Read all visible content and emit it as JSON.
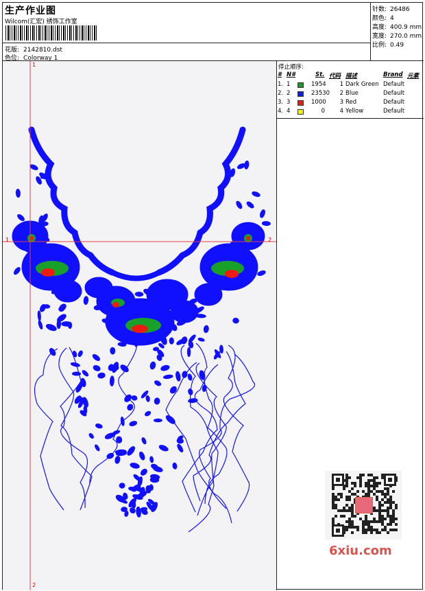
{
  "header": {
    "title": "生产作业图",
    "company": "Wilcom(汇宏) 绣饰工作室",
    "design_label": "花版:",
    "design_value": "2142810.dst",
    "colorway_label": "色位:",
    "colorway_value": "Colorway 1"
  },
  "specs": [
    {
      "label": "针数:",
      "value": "26486"
    },
    {
      "label": "颜色:",
      "value": "4"
    },
    {
      "label": "高度:",
      "value": "400.9 mm"
    },
    {
      "label": "宽度:",
      "value": "270.0 mm"
    },
    {
      "label": "比例:",
      "value": "0.49"
    }
  ],
  "stop_sequence": {
    "title": "停止顺序:",
    "columns": [
      "#",
      "N#",
      "St.",
      "代码",
      "描述",
      "Brand",
      "元素"
    ],
    "rows": [
      {
        "idx": "1.",
        "n": "1",
        "color": "#1a9a2a",
        "st": "1954",
        "code": "1",
        "desc": "Dark Green",
        "brand": "Default"
      },
      {
        "idx": "2.",
        "n": "2",
        "color": "#1020e8",
        "st": "23530",
        "code": "2",
        "desc": "Blue",
        "brand": "Default"
      },
      {
        "idx": "3.",
        "n": "3",
        "color": "#e8200c",
        "st": "1000",
        "code": "3",
        "desc": "Red",
        "brand": "Default"
      },
      {
        "idx": "4.",
        "n": "4",
        "color": "#f2f200",
        "st": "0",
        "code": "4",
        "desc": "Yellow",
        "brand": "Default"
      }
    ]
  },
  "canvas": {
    "axis_labels": {
      "top": "1",
      "bottom": "2",
      "left": "1",
      "right": "2"
    },
    "colors": {
      "embroidery": "#1010ff",
      "accent_green": "#18a02a",
      "accent_red": "#ee1c10",
      "crosshair": "#e04040"
    }
  },
  "watermark": {
    "text": "6xiu.com"
  }
}
